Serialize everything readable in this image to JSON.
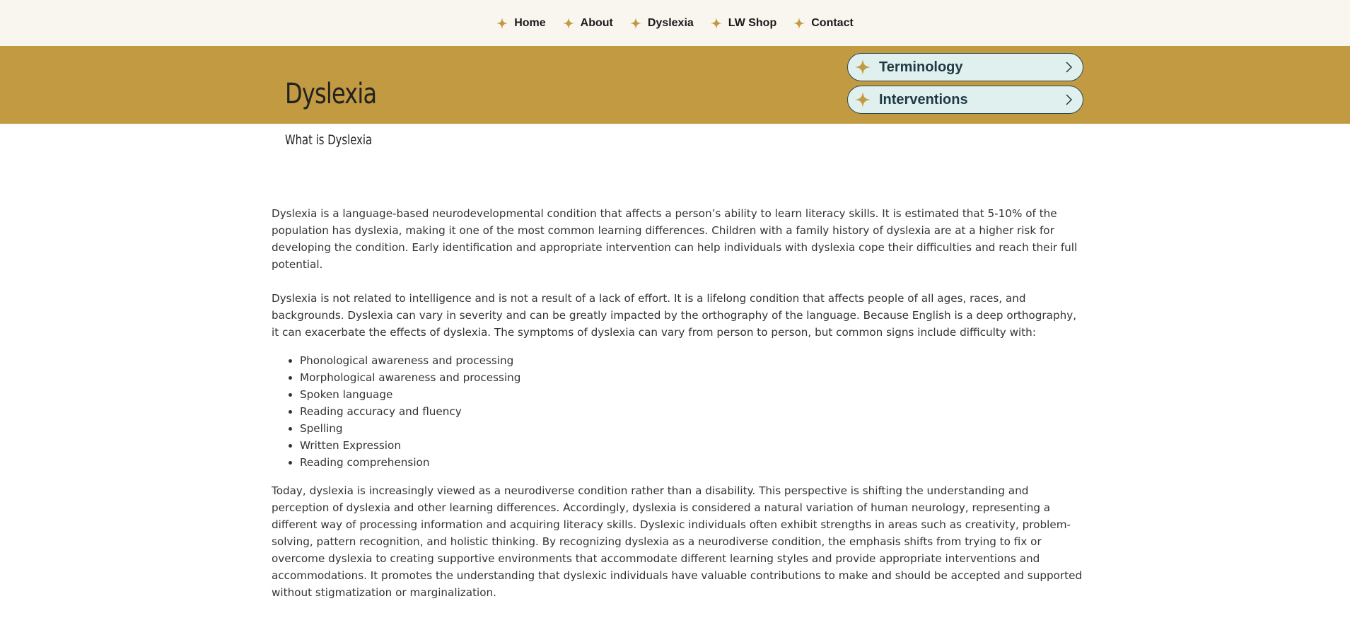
{
  "nav": {
    "items": [
      {
        "label": "Home"
      },
      {
        "label": "About"
      },
      {
        "label": "Dyslexia"
      },
      {
        "label": "LW Shop"
      },
      {
        "label": "Contact"
      }
    ],
    "icon": "sparkle-star-icon"
  },
  "banner": {
    "title": "Dyslexia",
    "links": [
      {
        "label": "Terminology",
        "icon": "sparkle-star-icon",
        "arrow": "chevron-right-icon"
      },
      {
        "label": "Interventions",
        "icon": "sparkle-star-icon",
        "arrow": "chevron-right-icon"
      }
    ]
  },
  "page": {
    "subtitle": "What is Dyslexia",
    "paragraphs": [
      "Dyslexia is a language-based neurodevelopmental condition that affects a person’s ability to learn literacy skills. It is estimated that 5-10% of the population has dyslexia, making it one of the most common learning differences. Children with a family history of dyslexia are at a higher risk for developing the condition. Early identification and appropriate intervention can help individuals with dyslexia cope their difficulties and reach their full potential.",
      "Dyslexia is not related to intelligence and is not a result of a lack of effort. It is a lifelong condition that affects people of all ages, races, and backgrounds. Dyslexia can vary in severity and can be greatly impacted by the orthography of the language. Because English is a deep orthography, it can exacerbate the effects of dyslexia. The symptoms of dyslexia can vary from person to person, but common signs include difficulty with:",
      "Today, dyslexia is increasingly viewed as a neurodiverse condition rather than a disability. This perspective is shifting the understanding and perception of dyslexia and other learning differences. Accordingly, dyslexia is considered a natural variation of human neurology, representing a different way of processing information and acquiring literacy skills. Dyslexic individuals often exhibit strengths in areas such as creativity, problem-solving, pattern recognition, and holistic thinking. By recognizing dyslexia as a neurodiverse condition, the emphasis shifts from trying to fix or overcome dyslexia to creating supportive environments that accommodate different learning styles and provide appropriate interventions and accommodations. It promotes the understanding that dyslexic individuals have valuable contributions to make and should be accepted and supported without stigmatization or marginalization."
    ],
    "list": [
      "Phonological awareness and processing",
      "Morphological awareness and processing",
      "Spoken language",
      "Reading accuracy and fluency",
      "Spelling",
      "Written Expression",
      "Reading comprehension"
    ]
  },
  "colors": {
    "nav_bg": "#f9f6f0",
    "banner_bg": "#c29a42",
    "star": "#c29a42",
    "pill_bg": "#e0f0ee",
    "pill_border": "#2a4a50"
  }
}
